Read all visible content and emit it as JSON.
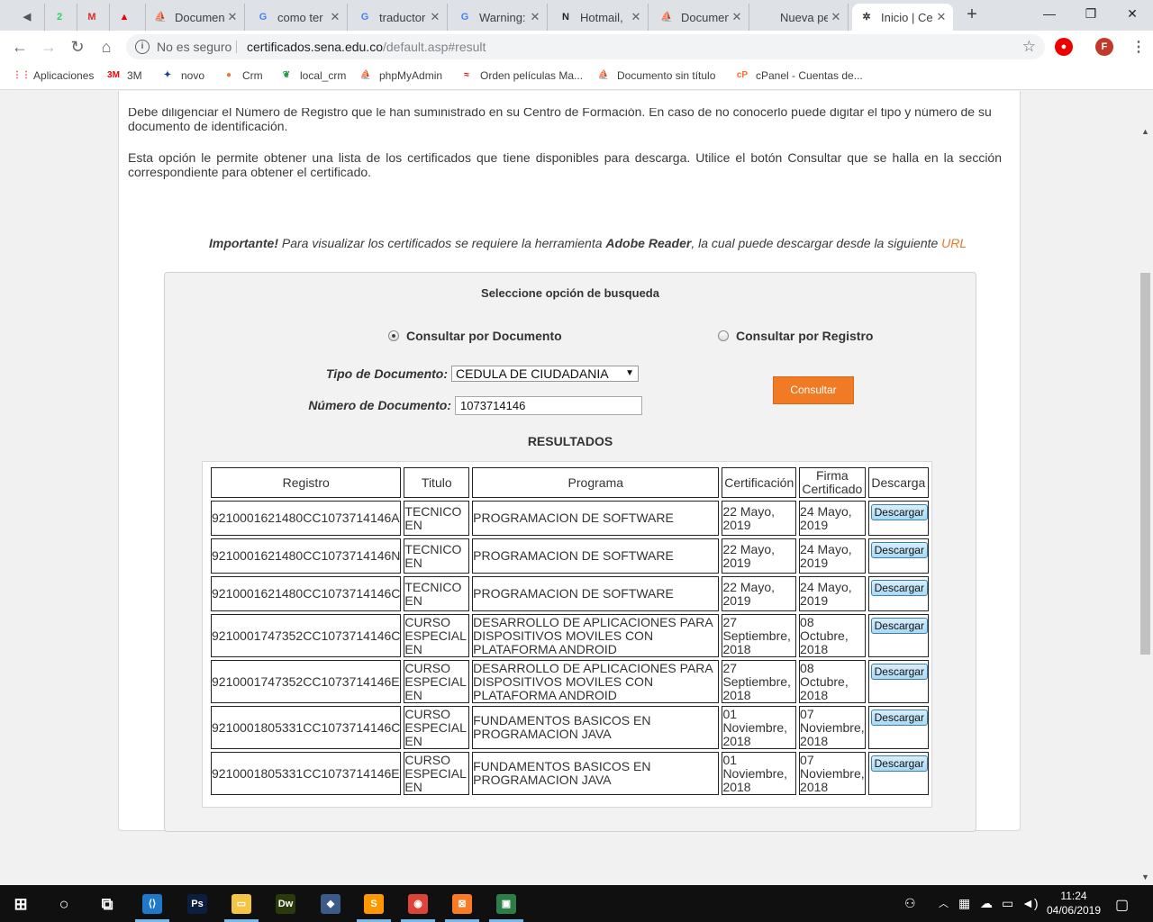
{
  "browser": {
    "tabs": [
      {
        "title": "",
        "icon": "speaker-icon",
        "favicon": "◀",
        "color": "#555"
      },
      {
        "title": "",
        "icon": "whatsapp-icon",
        "favicon": "2",
        "color": "#25d366"
      },
      {
        "title": "",
        "icon": "gmail-icon",
        "favicon": "M",
        "color": "#d93025"
      },
      {
        "title": "",
        "icon": "pdf-icon",
        "favicon": "▲",
        "color": "#e00"
      },
      {
        "title": "Documen",
        "icon": "sena-icon",
        "favicon": "⛵",
        "color": "#a00"
      },
      {
        "title": "como ter",
        "icon": "google-icon",
        "favicon": "G",
        "color": "#4285f4"
      },
      {
        "title": "traductor",
        "icon": "google-icon",
        "favicon": "G",
        "color": "#4285f4"
      },
      {
        "title": "Warning:",
        "icon": "google-icon",
        "favicon": "G",
        "color": "#4285f4"
      },
      {
        "title": "Hotmail,",
        "icon": "hotmail-icon",
        "favicon": "N",
        "color": "#222"
      },
      {
        "title": "Documen",
        "icon": "sena-icon",
        "favicon": "⛵",
        "color": "#a00"
      },
      {
        "title": "Nueva pestaña",
        "icon": "",
        "favicon": "",
        "color": "#555"
      },
      {
        "title": "Inicio | Ce",
        "icon": "sena-logo-icon",
        "favicon": "✲",
        "color": "#333"
      }
    ],
    "omnibox": {
      "security": "No es seguro",
      "host": "certificados.sena.edu.co",
      "path": "/default.asp#result"
    },
    "profile_initial": "F",
    "bookmarks": [
      {
        "label": "Aplicaciones",
        "icon": "apps-grid-icon",
        "glyph": "⋮⋮",
        "color": "#e94235"
      },
      {
        "label": "3M",
        "icon": "3m-logo-icon",
        "glyph": "3M",
        "color": "#e00"
      },
      {
        "label": "novo",
        "icon": "novo-icon",
        "glyph": "✦",
        "color": "#1a3c8f"
      },
      {
        "label": "Crm",
        "icon": "crm-icon",
        "glyph": "●",
        "color": "#e8773a"
      },
      {
        "label": "local_crm",
        "icon": "leaf-icon",
        "glyph": "❦",
        "color": "#1a9a3e"
      },
      {
        "label": "phpMyAdmin",
        "icon": "phpmyadmin-icon",
        "glyph": "⛵",
        "color": "#f29d00"
      },
      {
        "label": "Orden películas Ma...",
        "icon": "ribbon-icon",
        "glyph": "≈",
        "color": "#d00"
      },
      {
        "label": "Documento sin título",
        "icon": "sena-icon",
        "glyph": "⛵",
        "color": "#a00"
      },
      {
        "label": "cPanel - Cuentas de...",
        "icon": "cpanel-icon",
        "glyph": "cP",
        "color": "#ff6c2c"
      }
    ]
  },
  "page": {
    "intro_partial": "Debe diligenciar el Número de Registro que le han suministrado en su Centro de Formación. En caso de no conocerlo puede digitar el tipo y número de su",
    "intro_line2": "documento de identificación.",
    "option_text": "Esta opción le permite obtener una lista de los certificados que tiene disponibles para descarga. Utilice el botón Consultar que se halla en la sección correspondiente para obtener el certificado.",
    "important": {
      "label": "Importante!",
      "text_before": " Para visualizar los certificados se requiere la herramienta ",
      "tool": "Adobe Reader",
      "text_after": ", la cual puede descargar desde la siguiente ",
      "link": "URL"
    },
    "search": {
      "title": "Seleccione opción de busqueda",
      "option_documento": "Consultar por Documento",
      "option_registro": "Consultar por Registro",
      "selected_option": "documento",
      "tipo_label": "Tipo de Documento:",
      "tipo_value": "CEDULA DE CIUDADANIA",
      "numero_label": "Número de Documento:",
      "numero_value": "1073714146",
      "consultar_label": "Consultar"
    },
    "results": {
      "title": "RESULTADOS",
      "headers": [
        "Registro",
        "Titulo",
        "Programa",
        "Certificación",
        "Firma Certificado",
        "Descarga"
      ],
      "download_label": "Descargar",
      "rows": [
        {
          "registro": "9210001621480CC1073714146A",
          "titulo": "TECNICO EN",
          "programa": "PROGRAMACION DE SOFTWARE",
          "certificacion": "22 Mayo, 2019",
          "firma": "24 Mayo, 2019"
        },
        {
          "registro": "9210001621480CC1073714146N",
          "titulo": "TECNICO EN",
          "programa": "PROGRAMACION DE SOFTWARE",
          "certificacion": "22 Mayo, 2019",
          "firma": "24 Mayo, 2019"
        },
        {
          "registro": "9210001621480CC1073714146C",
          "titulo": "TECNICO EN",
          "programa": "PROGRAMACION DE SOFTWARE",
          "certificacion": "22 Mayo, 2019",
          "firma": "24 Mayo, 2019"
        },
        {
          "registro": "9210001747352CC1073714146C",
          "titulo": "CURSO ESPECIAL EN",
          "programa": "DESARROLLO DE APLICACIONES PARA DISPOSITIVOS MOVILES CON PLATAFORMA ANDROID",
          "certificacion": "27 Septiembre, 2018",
          "firma": "08 Octubre, 2018"
        },
        {
          "registro": "9210001747352CC1073714146E",
          "titulo": "CURSO ESPECIAL EN",
          "programa": "DESARROLLO DE APLICACIONES PARA DISPOSITIVOS MOVILES CON PLATAFORMA ANDROID",
          "certificacion": "27 Septiembre, 2018",
          "firma": "08 Octubre, 2018"
        },
        {
          "registro": "9210001805331CC1073714146C",
          "titulo": "CURSO ESPECIAL EN",
          "programa": "FUNDAMENTOS BASICOS EN PROGRAMACION JAVA",
          "certificacion": "01 Noviembre, 2018",
          "firma": "07 Noviembre, 2018"
        },
        {
          "registro": "9210001805331CC1073714146E",
          "titulo": "CURSO ESPECIAL EN",
          "programa": "FUNDAMENTOS BASICOS EN PROGRAMACION JAVA",
          "certificacion": "01 Noviembre, 2018",
          "firma": "07 Noviembre, 2018"
        }
      ]
    }
  },
  "taskbar": {
    "apps": [
      {
        "name": "windows-start-icon",
        "glyph": "⊞",
        "color": "transparent"
      },
      {
        "name": "cortana-icon",
        "glyph": "○",
        "color": "transparent"
      },
      {
        "name": "task-view-icon",
        "glyph": "⧉",
        "color": "transparent"
      },
      {
        "name": "vscode-icon",
        "glyph": "⟨⟩",
        "color": "#1f78c8"
      },
      {
        "name": "photoshop-icon",
        "glyph": "Ps",
        "color": "#0b1e3f"
      },
      {
        "name": "file-explorer-icon",
        "glyph": "▭",
        "color": "#f4c542"
      },
      {
        "name": "dreamweaver-icon",
        "glyph": "Dw",
        "color": "#2a3a0a"
      },
      {
        "name": "mysql-workbench-icon",
        "glyph": "◆",
        "color": "#3d5a88"
      },
      {
        "name": "sublime-text-icon",
        "glyph": "S",
        "color": "#ff9800"
      },
      {
        "name": "chrome-icon",
        "glyph": "◉",
        "color": "#db4437"
      },
      {
        "name": "xampp-icon",
        "glyph": "⊠",
        "color": "#fb7a24"
      },
      {
        "name": "remote-app-icon",
        "glyph": "▣",
        "color": "#2d7d46"
      }
    ],
    "time": "11:24",
    "date": "04/06/2019"
  },
  "colors": {
    "accent_orange": "#f07b24",
    "download_button": "#a9d9f3",
    "link": "#e8772e"
  }
}
